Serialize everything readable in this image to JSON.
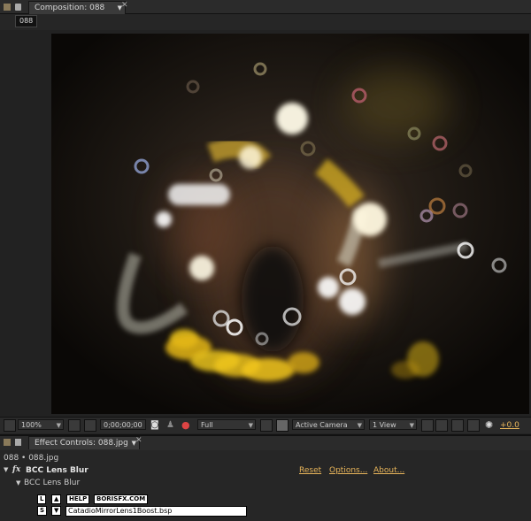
{
  "composition": {
    "tab_label": "Composition: 088",
    "comp_name_chip": "088"
  },
  "viewer_bar": {
    "zoom": "100%",
    "timecode": "0;00;00;00",
    "resolution": "Full",
    "camera": "Active Camera",
    "view_layout": "1 View",
    "exposure": "+0.0"
  },
  "effect_controls": {
    "tab_label": "Effect Controls: 088.jpg",
    "breadcrumb": "088 • 088.jpg",
    "effect_name": "BCC Lens Blur",
    "fx_badge": "fx",
    "reset_label": "Reset",
    "options_label": "Options...",
    "about_label": "About...",
    "group_label": "BCC Lens Blur",
    "btn_l": "L",
    "btn_s": "S",
    "up_glyph": "▲",
    "down_glyph": "▼",
    "help_label": "HELP",
    "borisfx_label": "BORISFX.COM",
    "preset_value": "CatadioMirrorLens1Boost.bsp"
  },
  "colors": {
    "accent_orange": "#e8b55a",
    "panel_bg": "#262626"
  }
}
